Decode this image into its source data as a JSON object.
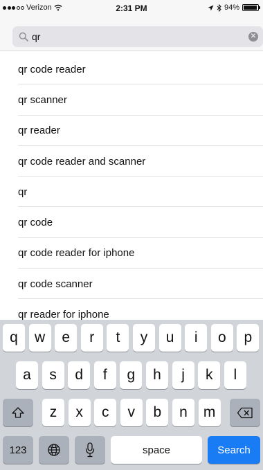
{
  "status_bar": {
    "carrier": "Verizon",
    "time": "2:31 PM",
    "battery": "94%",
    "battery_level": 0.94,
    "signal_bars_filled": 3,
    "signal_bars_total": 5
  },
  "search": {
    "query": "qr",
    "icons": {
      "search": "search-icon",
      "clear": "clear-icon"
    }
  },
  "suggestions": [
    "qr code reader",
    "qr scanner",
    "qr reader",
    "qr code reader and scanner",
    "qr",
    "qr code",
    "qr code reader for iphone",
    "qr code scanner",
    "qr reader for iphone"
  ],
  "keyboard": {
    "row1": [
      "q",
      "w",
      "e",
      "r",
      "t",
      "y",
      "u",
      "i",
      "o",
      "p"
    ],
    "row2": [
      "a",
      "s",
      "d",
      "f",
      "g",
      "h",
      "j",
      "k",
      "l"
    ],
    "row3": [
      "z",
      "x",
      "c",
      "v",
      "b",
      "n",
      "m"
    ],
    "numbers_label": "123",
    "space_label": "space",
    "search_label": "Search",
    "icons": {
      "shift": "shift-icon",
      "delete": "delete-icon",
      "globe": "globe-icon",
      "mic": "microphone-icon"
    }
  },
  "colors": {
    "accent": "#1a7cf5",
    "keyboard_bg": "#d1d4d9",
    "key_gray": "#abb1ba",
    "search_field_bg": "#e3e3e8"
  }
}
